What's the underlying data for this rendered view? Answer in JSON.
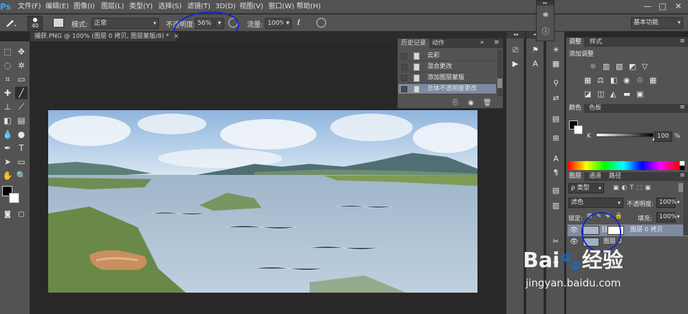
{
  "app": {
    "logo": "Ps"
  },
  "menu": [
    "文件(F)",
    "编辑(E)",
    "图像(I)",
    "图层(L)",
    "类型(Y)",
    "选择(S)",
    "滤镜(T)",
    "3D(D)",
    "视图(V)",
    "窗口(W)",
    "帮助(H)"
  ],
  "window_controls": {
    "minimize": "—",
    "maximize": "□",
    "close": "✕"
  },
  "options": {
    "brush_size": "40",
    "mode_label": "模式:",
    "mode_value": "正常",
    "opacity_label": "不透明度:",
    "opacity_value": "56%",
    "flow_label": "流量:",
    "flow_value": "100%",
    "workspace": "基本功能"
  },
  "document": {
    "tab_title": "捕获.PNG @ 100% (图层 0 拷贝, 图层蒙版/8) *",
    "close": "×"
  },
  "history": {
    "tabs": [
      "历史记录",
      "动作"
    ],
    "items": [
      "云彩",
      "混合更改",
      "添加图层蒙版",
      "总体不透明度更改"
    ]
  },
  "adjustments": {
    "tabs": [
      "调整",
      "样式"
    ],
    "title": "添加调整"
  },
  "color": {
    "tabs": [
      "颜色",
      "色板"
    ],
    "k_label": "K",
    "k_value": "100",
    "unit": "%",
    "k_level": 1.0
  },
  "layers": {
    "tabs": [
      "图层",
      "通道",
      "路径"
    ],
    "filter_label": "ρ 类型",
    "blend_mode": "滤色",
    "opacity_label": "不透明度:",
    "opacity_value": "100%",
    "lock_label": "锁定:",
    "fill_label": "填充:",
    "fill_value": "100%",
    "items": [
      {
        "name": "图层 0 拷贝"
      },
      {
        "name": "图层 0"
      }
    ]
  },
  "watermark": {
    "brand": "Bai",
    "brand2": "经验",
    "url": "jingyan.baidu.com"
  },
  "colors": {
    "panel": "#535353",
    "dark": "#282828",
    "accent": "#3aa3f1",
    "annotation": "#1228c8"
  }
}
